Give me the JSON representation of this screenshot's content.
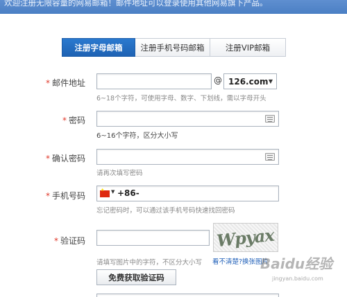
{
  "banner": {
    "text": "欢迎注册无限容量的网易邮箱！邮件地址可以登录使用其他网易旗下产品。"
  },
  "tabs": [
    {
      "label": "注册字母邮箱",
      "active": true
    },
    {
      "label": "注册手机号码邮箱",
      "active": false
    },
    {
      "label": "注册VIP邮箱",
      "active": false
    }
  ],
  "form": {
    "required_mark": "*",
    "email": {
      "label": "邮件地址",
      "value": "",
      "at": "@",
      "domain": "126.com",
      "hint": "6~18个字符，可使用字母、数字、下划线，需以字母开头"
    },
    "password": {
      "label": "密码",
      "value": "",
      "hint": "6~16个字符，区分大小写"
    },
    "confirm_password": {
      "label": "确认密码",
      "value": "",
      "hint": "请再次填写密码"
    },
    "phone": {
      "label": "手机号码",
      "country_code": "+86-",
      "value": "",
      "hint": "忘记密码时，可以通过该手机号码快速找回密码"
    },
    "captcha": {
      "label": "验证码",
      "value": "",
      "image_text": "Wpyax",
      "hint": "请填写图片中的字符，不区分大小写",
      "unclear_link": "看不清楚?",
      "change_link": "换张图片"
    },
    "sms_button": {
      "label": "免费获取验证码"
    }
  },
  "watermark": {
    "text": "Baidu经验",
    "sub": "jingyan.baidu.com"
  },
  "colors": {
    "accent": "#1e62b3",
    "required": "#e0392b",
    "link": "#1f5fb8"
  },
  "icons": [
    "keyboard-icon",
    "china-flag-icon",
    "dropdown-arrow-icon"
  ]
}
